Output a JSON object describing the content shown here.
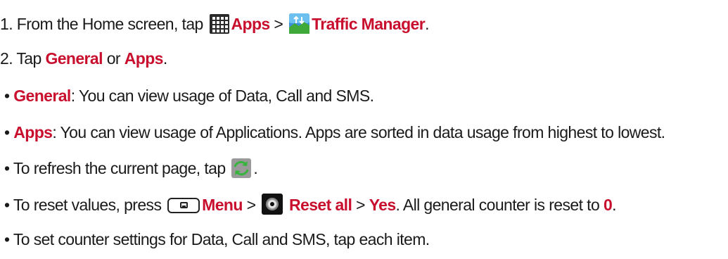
{
  "step1": {
    "prefix": "1. From the Home screen, tap",
    "apps_label": "Apps",
    "sep": ">",
    "traffic_label": "Traffic Manager",
    "end": ".",
    "icons": [
      "apps-grid-icon",
      "traffic-manager-icon"
    ]
  },
  "step2": {
    "prefix": "2. Tap",
    "general": "General",
    "or": "or",
    "apps": "Apps",
    "end": "."
  },
  "bullet_general": {
    "bullet": "•",
    "term": "General",
    "text": ": You can view usage of Data, Call and SMS."
  },
  "bullet_apps": {
    "bullet": "•",
    "term": "Apps",
    "text": ": You can view usage of Applications. Apps are sorted in data usage from highest to lowest."
  },
  "bullet_refresh": {
    "text": "• To refresh the current page, tap",
    "end": ".",
    "icon": "refresh-icon"
  },
  "bullet_reset": {
    "prefix": "• To reset values, press",
    "menu": "Menu",
    "sep1": ">",
    "reset_all": "Reset all",
    "sep2": ">",
    "yes": "Yes",
    "middle": ". All general counter is reset to",
    "zero": "0",
    "end": ".",
    "icons": [
      "menu-key-icon",
      "reset-all-icon"
    ]
  },
  "bullet_counter": {
    "text": "• To set counter settings for Data, Call and SMS, tap each item."
  },
  "colors": {
    "highlight": "#c8102e",
    "text": "#1a1a1a"
  }
}
